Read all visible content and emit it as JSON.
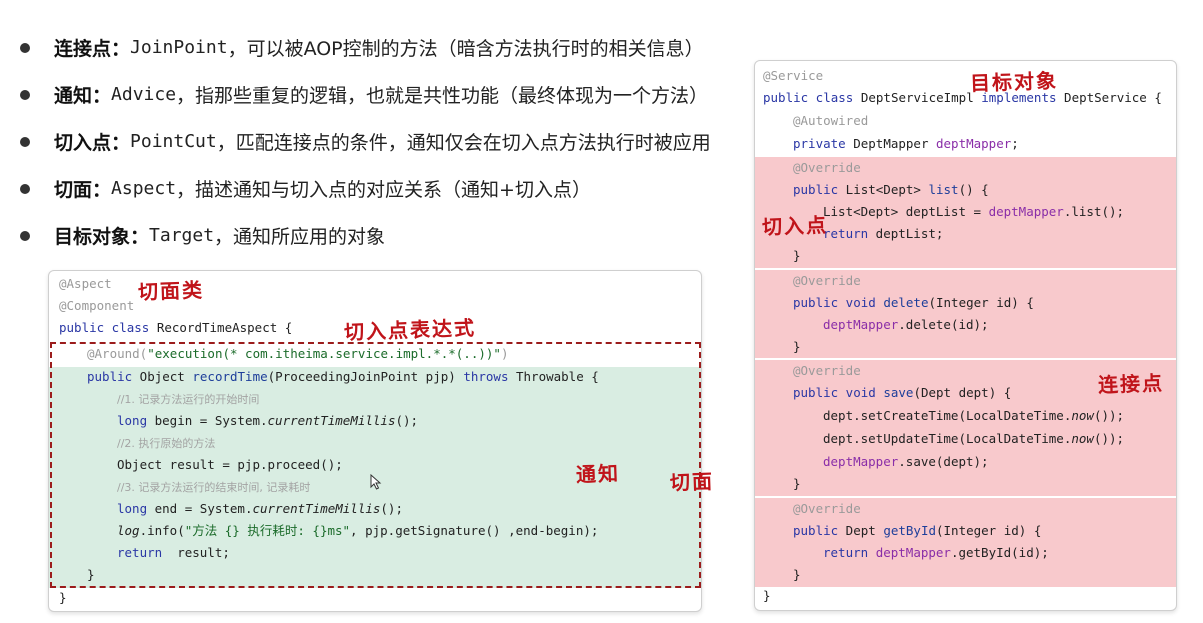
{
  "bullets": [
    {
      "term": "连接点：",
      "code": "JoinPoint",
      "desc": "，可以被AOP控制的方法（暗含方法执行时的相关信息）"
    },
    {
      "term": "通知：",
      "code": "Advice",
      "desc": "，指那些重复的逻辑，也就是共性功能（最终体现为一个方法）"
    },
    {
      "term": "切入点：",
      "code": "PointCut",
      "desc": "，匹配连接点的条件，通知仅会在切入点方法执行时被应用"
    },
    {
      "term": "切面：",
      "code": "Aspect",
      "desc": "，描述通知与切入点的对应关系（通知+切入点）"
    },
    {
      "term": "目标对象：",
      "code": "Target",
      "desc": "，通知所应用的对象"
    }
  ],
  "left_code": {
    "l1": "@Aspect",
    "l2": "@Component",
    "l3a": "public class",
    "l3b": " RecordTimeAspect {",
    "l4a": "@Around(",
    "l4b": "\"execution(* com.itheima.service.impl.*.*(..))\"",
    "l4c": ")",
    "l5a": "public",
    "l5b": " Object ",
    "l5c": "recordTime",
    "l5d": "(ProceedingJoinPoint pjp) ",
    "l5e": "throws",
    "l5f": " Throwable {",
    "l6": "//1. 记录方法运行的开始时间",
    "l7a": "long",
    "l7b": " begin = System.",
    "l7c": "currentTimeMillis",
    "l7d": "();",
    "l8": "//2. 执行原始的方法",
    "l9": "Object result = pjp.proceed();",
    "l10": "//3. 记录方法运行的结束时间, 记录耗时",
    "l11a": "long",
    "l11b": " end = System.",
    "l11c": "currentTimeMillis",
    "l11d": "();",
    "l12a": "log",
    "l12b": ".info(",
    "l12c": "\"方法 {} 执行耗时: {}ms\"",
    "l12d": ", pjp.getSignature() ,end-begin);",
    "l13a": "return",
    "l13b": "  result;",
    "l14": "}",
    "l15": "}"
  },
  "right_code": {
    "r1": "@Service",
    "r2a": "public class",
    "r2b": " DeptServiceImpl ",
    "r2c": "implements",
    "r2d": " DeptService {",
    "r3": "@Autowired",
    "r4a": "private",
    "r4b": " DeptMapper ",
    "r4c": "deptMapper",
    "r4d": ";",
    "r5": "@Override",
    "r6a": "public",
    "r6b": " List<Dept> ",
    "r6c": "list",
    "r6d": "() {",
    "r7a": "List<Dept> deptList = ",
    "r7b": "deptMapper",
    "r7c": ".list();",
    "r8a": "return",
    "r8b": " deptList;",
    "r9": "}",
    "r10": "@Override",
    "r11a": "public void",
    "r11b": " ",
    "r11c": "delete",
    "r11d": "(Integer id) {",
    "r12a": "deptMapper",
    "r12b": ".delete(id);",
    "r13": "}",
    "r14": "@Override",
    "r15a": "public void",
    "r15b": " ",
    "r15c": "save",
    "r15d": "(Dept dept) {",
    "r16a": "dept.setCreateTime(LocalDateTime.",
    "r16b": "now",
    "r16c": "());",
    "r17a": "dept.setUpdateTime(LocalDateTime.",
    "r17b": "now",
    "r17c": "());",
    "r18a": "deptMapper",
    "r18b": ".save(dept);",
    "r19": "}",
    "r20": "@Override",
    "r21a": "public",
    "r21b": " Dept ",
    "r21c": "getById",
    "r21d": "(Integer id) {",
    "r22a": "return",
    "r22b": " ",
    "r22c": "deptMapper",
    "r22d": ".getById(id);",
    "r23": "}",
    "r24": "}"
  },
  "handwritten": {
    "aspect_class": "切面类",
    "pointcut_expr": "切入点表达式",
    "advice": "通知",
    "aspect": "切面",
    "target": "目标对象",
    "pointcut": "切入点",
    "joinpoint": "连接点"
  },
  "colors": {
    "advice_bg": "#d9ede2",
    "method_bg": "#f8c9cc",
    "handwriting": "#c0141a",
    "dashed_border": "#9b1c1c"
  }
}
